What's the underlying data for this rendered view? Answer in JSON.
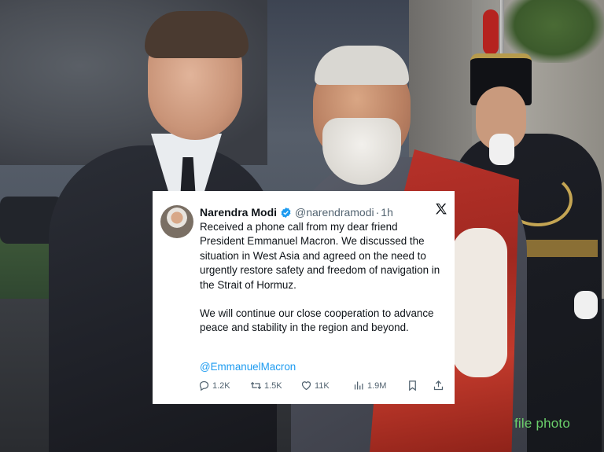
{
  "tweet": {
    "author_name": "Narendra Modi",
    "handle": "@narendramodi",
    "separator": "·",
    "time": "1h",
    "paragraphs": [
      "Received a phone call from my dear friend President Emmanuel Macron. We discussed the situation in West Asia and agreed on the need to urgently restore safety and freedom of navigation in the Strait of Hormuz.",
      "We will continue our close cooperation to advance peace and stability in the region and beyond."
    ],
    "mention": "@EmmanuelMacron",
    "actions": {
      "replies": "1.2K",
      "reposts": "1.5K",
      "likes": "11K",
      "views": "1.9M"
    }
  },
  "watermark": "file photo",
  "colors": {
    "verified": "#1d9bf0",
    "link": "#1d9bf0",
    "watermark": "#6bd06b"
  },
  "icons": [
    "verified-badge-icon",
    "x-logo-icon",
    "reply-icon",
    "repost-icon",
    "like-icon",
    "views-icon",
    "bookmark-icon",
    "share-icon"
  ]
}
